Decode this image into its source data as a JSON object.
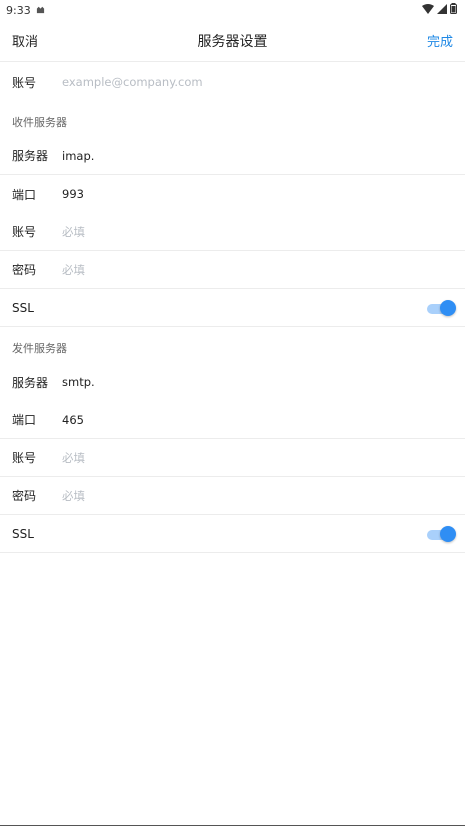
{
  "status_bar": {
    "time": "9:33"
  },
  "header": {
    "cancel_label": "取消",
    "title": "服务器设置",
    "done_label": "完成"
  },
  "account": {
    "label": "账号",
    "placeholder": "example@company.com"
  },
  "incoming": {
    "section_title": "收件服务器",
    "server_label": "服务器",
    "server_value": "imap.",
    "port_label": "端口",
    "port_value": "993",
    "account_label": "账号",
    "account_placeholder": "必填",
    "password_label": "密码",
    "password_placeholder": "必填",
    "ssl_label": "SSL",
    "ssl_enabled": true
  },
  "outgoing": {
    "section_title": "发件服务器",
    "server_label": "服务器",
    "server_value": "smtp.",
    "port_label": "端口",
    "port_value": "465",
    "account_label": "账号",
    "account_placeholder": "必填",
    "password_label": "密码",
    "password_placeholder": "必填",
    "ssl_label": "SSL",
    "ssl_enabled": true
  },
  "colors": {
    "accent": "#1e88e5",
    "toggle_thumb": "#2f8ef4",
    "toggle_track": "#a9d0fb",
    "placeholder": "#b8bdc4"
  }
}
